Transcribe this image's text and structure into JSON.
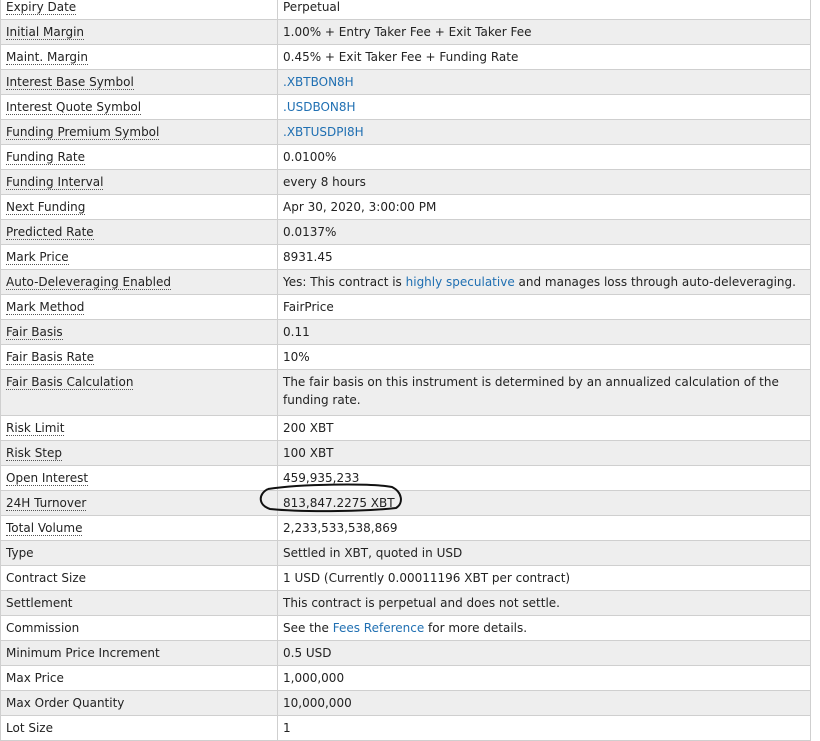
{
  "rows": [
    {
      "label": "Expiry Date",
      "tip": true,
      "value": [
        {
          "t": "Perpetual"
        }
      ]
    },
    {
      "label": "Initial Margin",
      "tip": true,
      "value": [
        {
          "t": "1.00% + Entry Taker Fee + Exit Taker Fee"
        }
      ]
    },
    {
      "label": "Maint. Margin",
      "tip": true,
      "value": [
        {
          "t": "0.45% + Exit Taker Fee + Funding Rate"
        }
      ]
    },
    {
      "label": "Interest Base Symbol",
      "tip": true,
      "value": [
        {
          "t": ".XBTBON8H",
          "link": true
        }
      ]
    },
    {
      "label": "Interest Quote Symbol",
      "tip": true,
      "value": [
        {
          "t": ".USDBON8H",
          "link": true
        }
      ]
    },
    {
      "label": "Funding Premium Symbol",
      "tip": true,
      "value": [
        {
          "t": ".XBTUSDPI8H",
          "link": true
        }
      ]
    },
    {
      "label": "Funding Rate",
      "tip": true,
      "value": [
        {
          "t": "0.0100%"
        }
      ]
    },
    {
      "label": "Funding Interval",
      "tip": true,
      "value": [
        {
          "t": "every 8 hours"
        }
      ]
    },
    {
      "label": "Next Funding",
      "tip": true,
      "value": [
        {
          "t": "Apr 30, 2020, 3:00:00 PM"
        }
      ]
    },
    {
      "label": "Predicted Rate",
      "tip": true,
      "value": [
        {
          "t": "0.0137%"
        }
      ]
    },
    {
      "label": "Mark Price",
      "tip": true,
      "value": [
        {
          "t": "8931.45"
        }
      ]
    },
    {
      "label": "Auto-Deleveraging Enabled",
      "tip": true,
      "value": [
        {
          "t": "Yes: This contract is "
        },
        {
          "t": "highly speculative",
          "link": true
        },
        {
          "t": " and manages loss through auto-deleveraging."
        }
      ]
    },
    {
      "label": "Mark Method",
      "tip": true,
      "value": [
        {
          "t": "FairPrice"
        }
      ]
    },
    {
      "label": "Fair Basis",
      "tip": true,
      "value": [
        {
          "t": "0.11"
        }
      ]
    },
    {
      "label": "Fair Basis Rate",
      "tip": true,
      "value": [
        {
          "t": "10%"
        }
      ]
    },
    {
      "label": "Fair Basis Calculation",
      "tip": true,
      "tall": true,
      "value": [
        {
          "t": "The fair basis on this instrument is determined by an annualized calculation of the funding rate."
        }
      ]
    },
    {
      "label": "Risk Limit",
      "tip": true,
      "value": [
        {
          "t": "200 XBT"
        }
      ]
    },
    {
      "label": "Risk Step",
      "tip": true,
      "value": [
        {
          "t": "100 XBT"
        }
      ]
    },
    {
      "label": "Open Interest",
      "tip": true,
      "value": [
        {
          "t": "459,935,233"
        }
      ]
    },
    {
      "label": "24H Turnover",
      "tip": true,
      "value": [
        {
          "t": "813,847.2275 XBT"
        }
      ]
    },
    {
      "label": "Total Volume",
      "tip": true,
      "value": [
        {
          "t": "2,233,533,538,869"
        }
      ]
    },
    {
      "label": "Type",
      "value": [
        {
          "t": "Settled in XBT, quoted in USD"
        }
      ]
    },
    {
      "label": "Contract Size",
      "value": [
        {
          "t": "1 USD (Currently 0.00011196 XBT per contract)"
        }
      ]
    },
    {
      "label": "Settlement",
      "value": [
        {
          "t": "This contract is perpetual and does not settle."
        }
      ]
    },
    {
      "label": "Commission",
      "value": [
        {
          "t": "See the "
        },
        {
          "t": "Fees Reference",
          "link": true
        },
        {
          "t": " for more details."
        }
      ]
    },
    {
      "label": "Minimum Price Increment",
      "value": [
        {
          "t": "0.5 USD"
        }
      ]
    },
    {
      "label": "Max Price",
      "value": [
        {
          "t": "1,000,000"
        }
      ]
    },
    {
      "label": "Max Order Quantity",
      "value": [
        {
          "t": "10,000,000"
        }
      ]
    },
    {
      "label": "Lot Size",
      "value": [
        {
          "t": "1"
        }
      ]
    }
  ],
  "colors": {
    "link": "#1f6fb2",
    "stripe": "#eeeeee",
    "border": "#cfcfcf",
    "annotation": "#111111"
  }
}
